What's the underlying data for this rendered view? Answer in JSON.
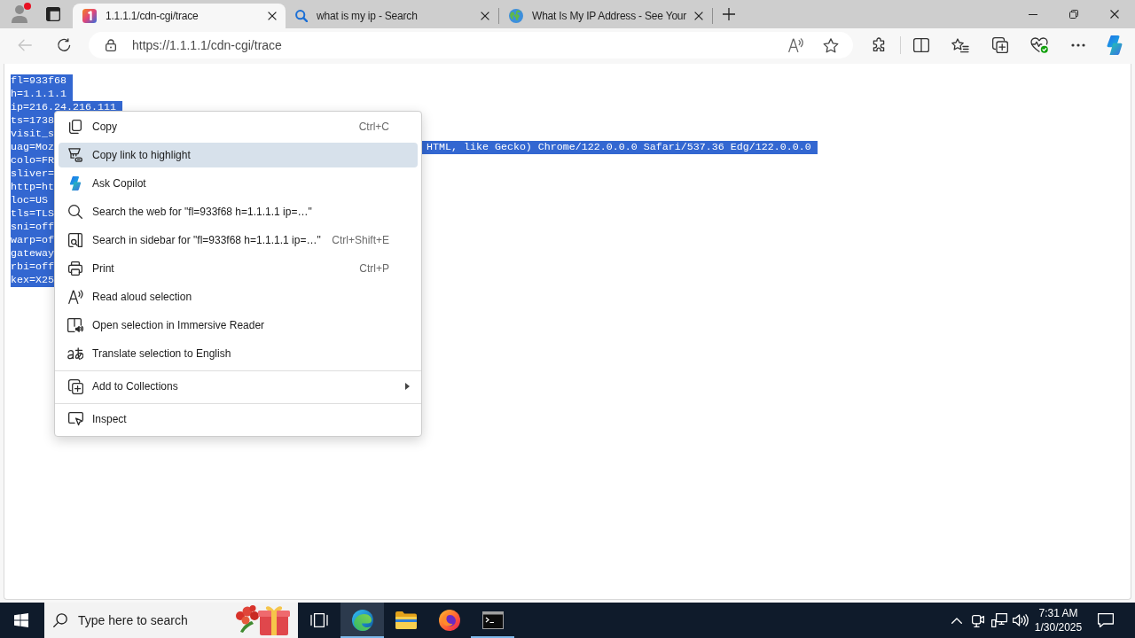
{
  "profile": {
    "notification": true
  },
  "tabs": [
    {
      "title": "1.1.1.1/cdn-cgi/trace",
      "selected": true
    },
    {
      "title": "what is my ip - Search",
      "selected": false
    },
    {
      "title": "What Is My IP Address - See Your",
      "selected": false
    }
  ],
  "toolbar": {
    "back": {
      "disabled": true
    },
    "url": "https://1.1.1.1/cdn-cgi/trace"
  },
  "page": {
    "lines": [
      {
        "text": "fl=933f68",
        "selected": true
      },
      {
        "text": "h=1.1.1.1",
        "selected": true
      },
      {
        "text": "ip=216.24.216.111",
        "selected": true
      },
      {
        "text": "ts=1738",
        "selected": true
      },
      {
        "text": "visit_s",
        "selected": true
      },
      {
        "text": "uag=Moz",
        "continuation": "HTML, like Gecko) Chrome/122.0.0.0 Safari/537.36 Edg/122.0.0.0",
        "selected": true
      },
      {
        "text": "colo=FR",
        "selected": true
      },
      {
        "text": "sliver=",
        "selected": true
      },
      {
        "text": "http=ht",
        "selected": true
      },
      {
        "text": "loc=US",
        "selected": true
      },
      {
        "text": "tls=TLS",
        "selected": true
      },
      {
        "text": "sni=off",
        "selected": true
      },
      {
        "text": "warp=of",
        "selected": true
      },
      {
        "text": "gateway",
        "selected": true
      },
      {
        "text": "rbi=off",
        "selected": true
      },
      {
        "text": "kex=X25",
        "selected": true
      }
    ]
  },
  "context_menu": {
    "sections": [
      {
        "items": [
          {
            "label": "Copy",
            "shortcut": "Ctrl+C",
            "selected": false,
            "submenu": false
          },
          {
            "label": "Copy link to highlight",
            "selected": true,
            "submenu": false
          },
          {
            "label": "Ask Copilot",
            "selected": false,
            "submenu": false
          },
          {
            "label": "Search the web for \"fl=933f68 h=1.1.1.1 ip=…\"",
            "selected": false,
            "submenu": false
          },
          {
            "label": "Search in sidebar for \"fl=933f68 h=1.1.1.1 ip=…\"",
            "shortcut": "Ctrl+Shift+E",
            "selected": false,
            "submenu": false
          },
          {
            "label": "Print",
            "shortcut": "Ctrl+P",
            "selected": false,
            "submenu": false
          },
          {
            "label": "Read aloud selection",
            "selected": false,
            "submenu": false
          },
          {
            "label": "Open selection in Immersive Reader",
            "selected": false,
            "submenu": false
          },
          {
            "label": "Translate selection to English",
            "selected": false,
            "submenu": false
          }
        ]
      },
      {
        "items": [
          {
            "label": "Add to Collections",
            "selected": false,
            "submenu": true
          }
        ]
      },
      {
        "items": [
          {
            "label": "Inspect",
            "selected": false,
            "submenu": false
          }
        ]
      }
    ]
  },
  "taskbar": {
    "search": {
      "placeholder": "Type here to search"
    },
    "apps": [
      {
        "active": true,
        "running": true
      },
      {
        "active": false,
        "running": false
      },
      {
        "active": false,
        "running": false
      },
      {
        "active": false,
        "running": true
      }
    ],
    "clock": {
      "time": "7:31 AM",
      "date": "1/30/2025"
    }
  }
}
